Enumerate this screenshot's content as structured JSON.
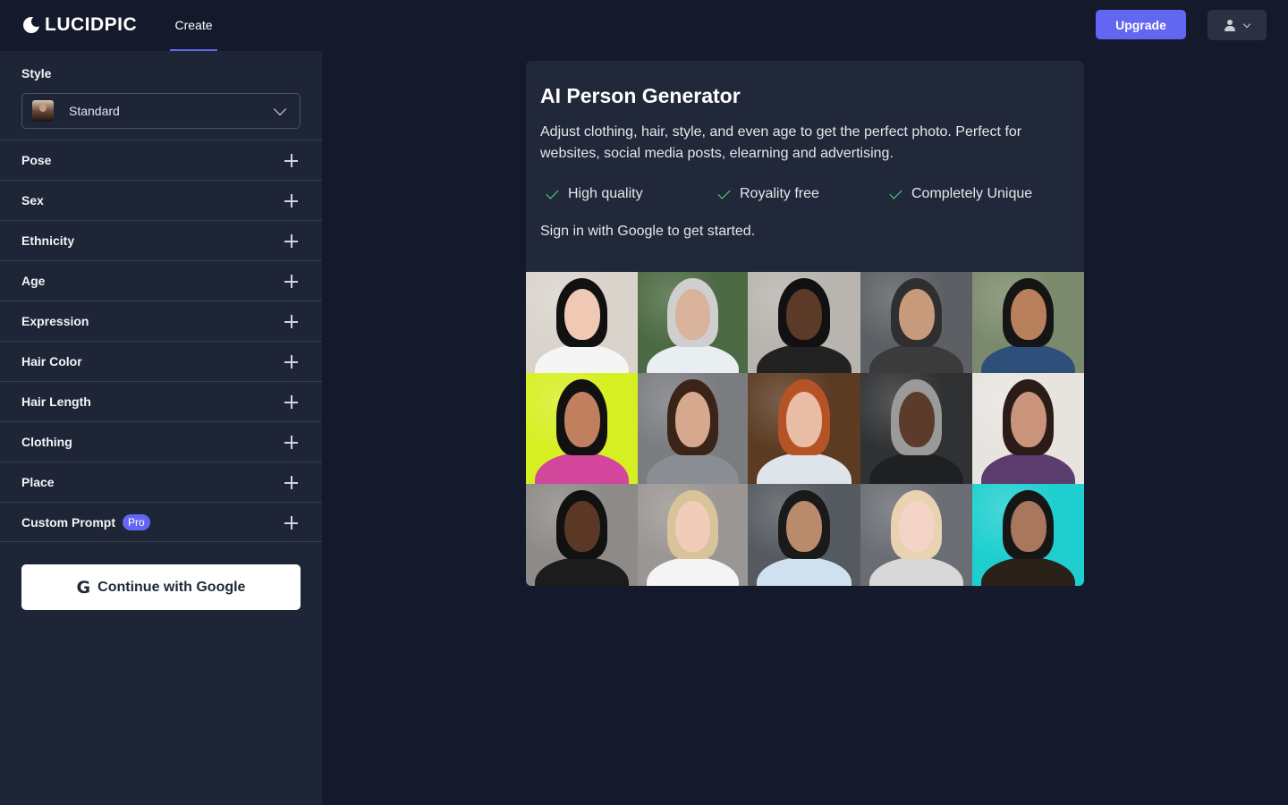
{
  "header": {
    "logo_text": "LUCIDPIC",
    "nav_tab": "Create",
    "upgrade_label": "Upgrade",
    "user_icon": "user-icon",
    "dropdown_icon": "chevron-down-icon"
  },
  "sidebar": {
    "style_label": "Style",
    "style_value": "Standard",
    "accordion": [
      {
        "label": "Pose"
      },
      {
        "label": "Sex"
      },
      {
        "label": "Ethnicity"
      },
      {
        "label": "Age"
      },
      {
        "label": "Expression"
      },
      {
        "label": "Hair Color"
      },
      {
        "label": "Hair Length"
      },
      {
        "label": "Clothing"
      },
      {
        "label": "Place"
      },
      {
        "label": "Custom Prompt",
        "badge": "Pro"
      }
    ],
    "google_button": "Continue with Google"
  },
  "card": {
    "title": "AI Person Generator",
    "description": "Adjust clothing, hair, style, and even age to get the perfect photo. Perfect for websites, social media posts, elearning and advertising.",
    "features": [
      "High quality",
      "Royality free",
      "Completely Unique"
    ],
    "signin_text": "Sign in with Google to get started."
  },
  "colors": {
    "background": "#141a2b",
    "sidebar": "#1e2536",
    "card": "#202839",
    "accent": "#6366f1",
    "check": "#4ade80"
  }
}
